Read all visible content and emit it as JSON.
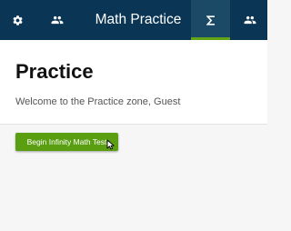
{
  "topbar": {
    "title": "Math Practice",
    "background": "#0a3554",
    "active_color": "#62a516",
    "icons": {
      "left1": "gear-icon",
      "left2": "people-icon",
      "active": "sigma-icon",
      "right": "people-icon"
    }
  },
  "main": {
    "heading": "Practice",
    "welcome_text": "Welcome to the Practice zone, Guest",
    "start_button_label": "Begin Infinity Math Test",
    "button_color": "#5a9e12"
  }
}
